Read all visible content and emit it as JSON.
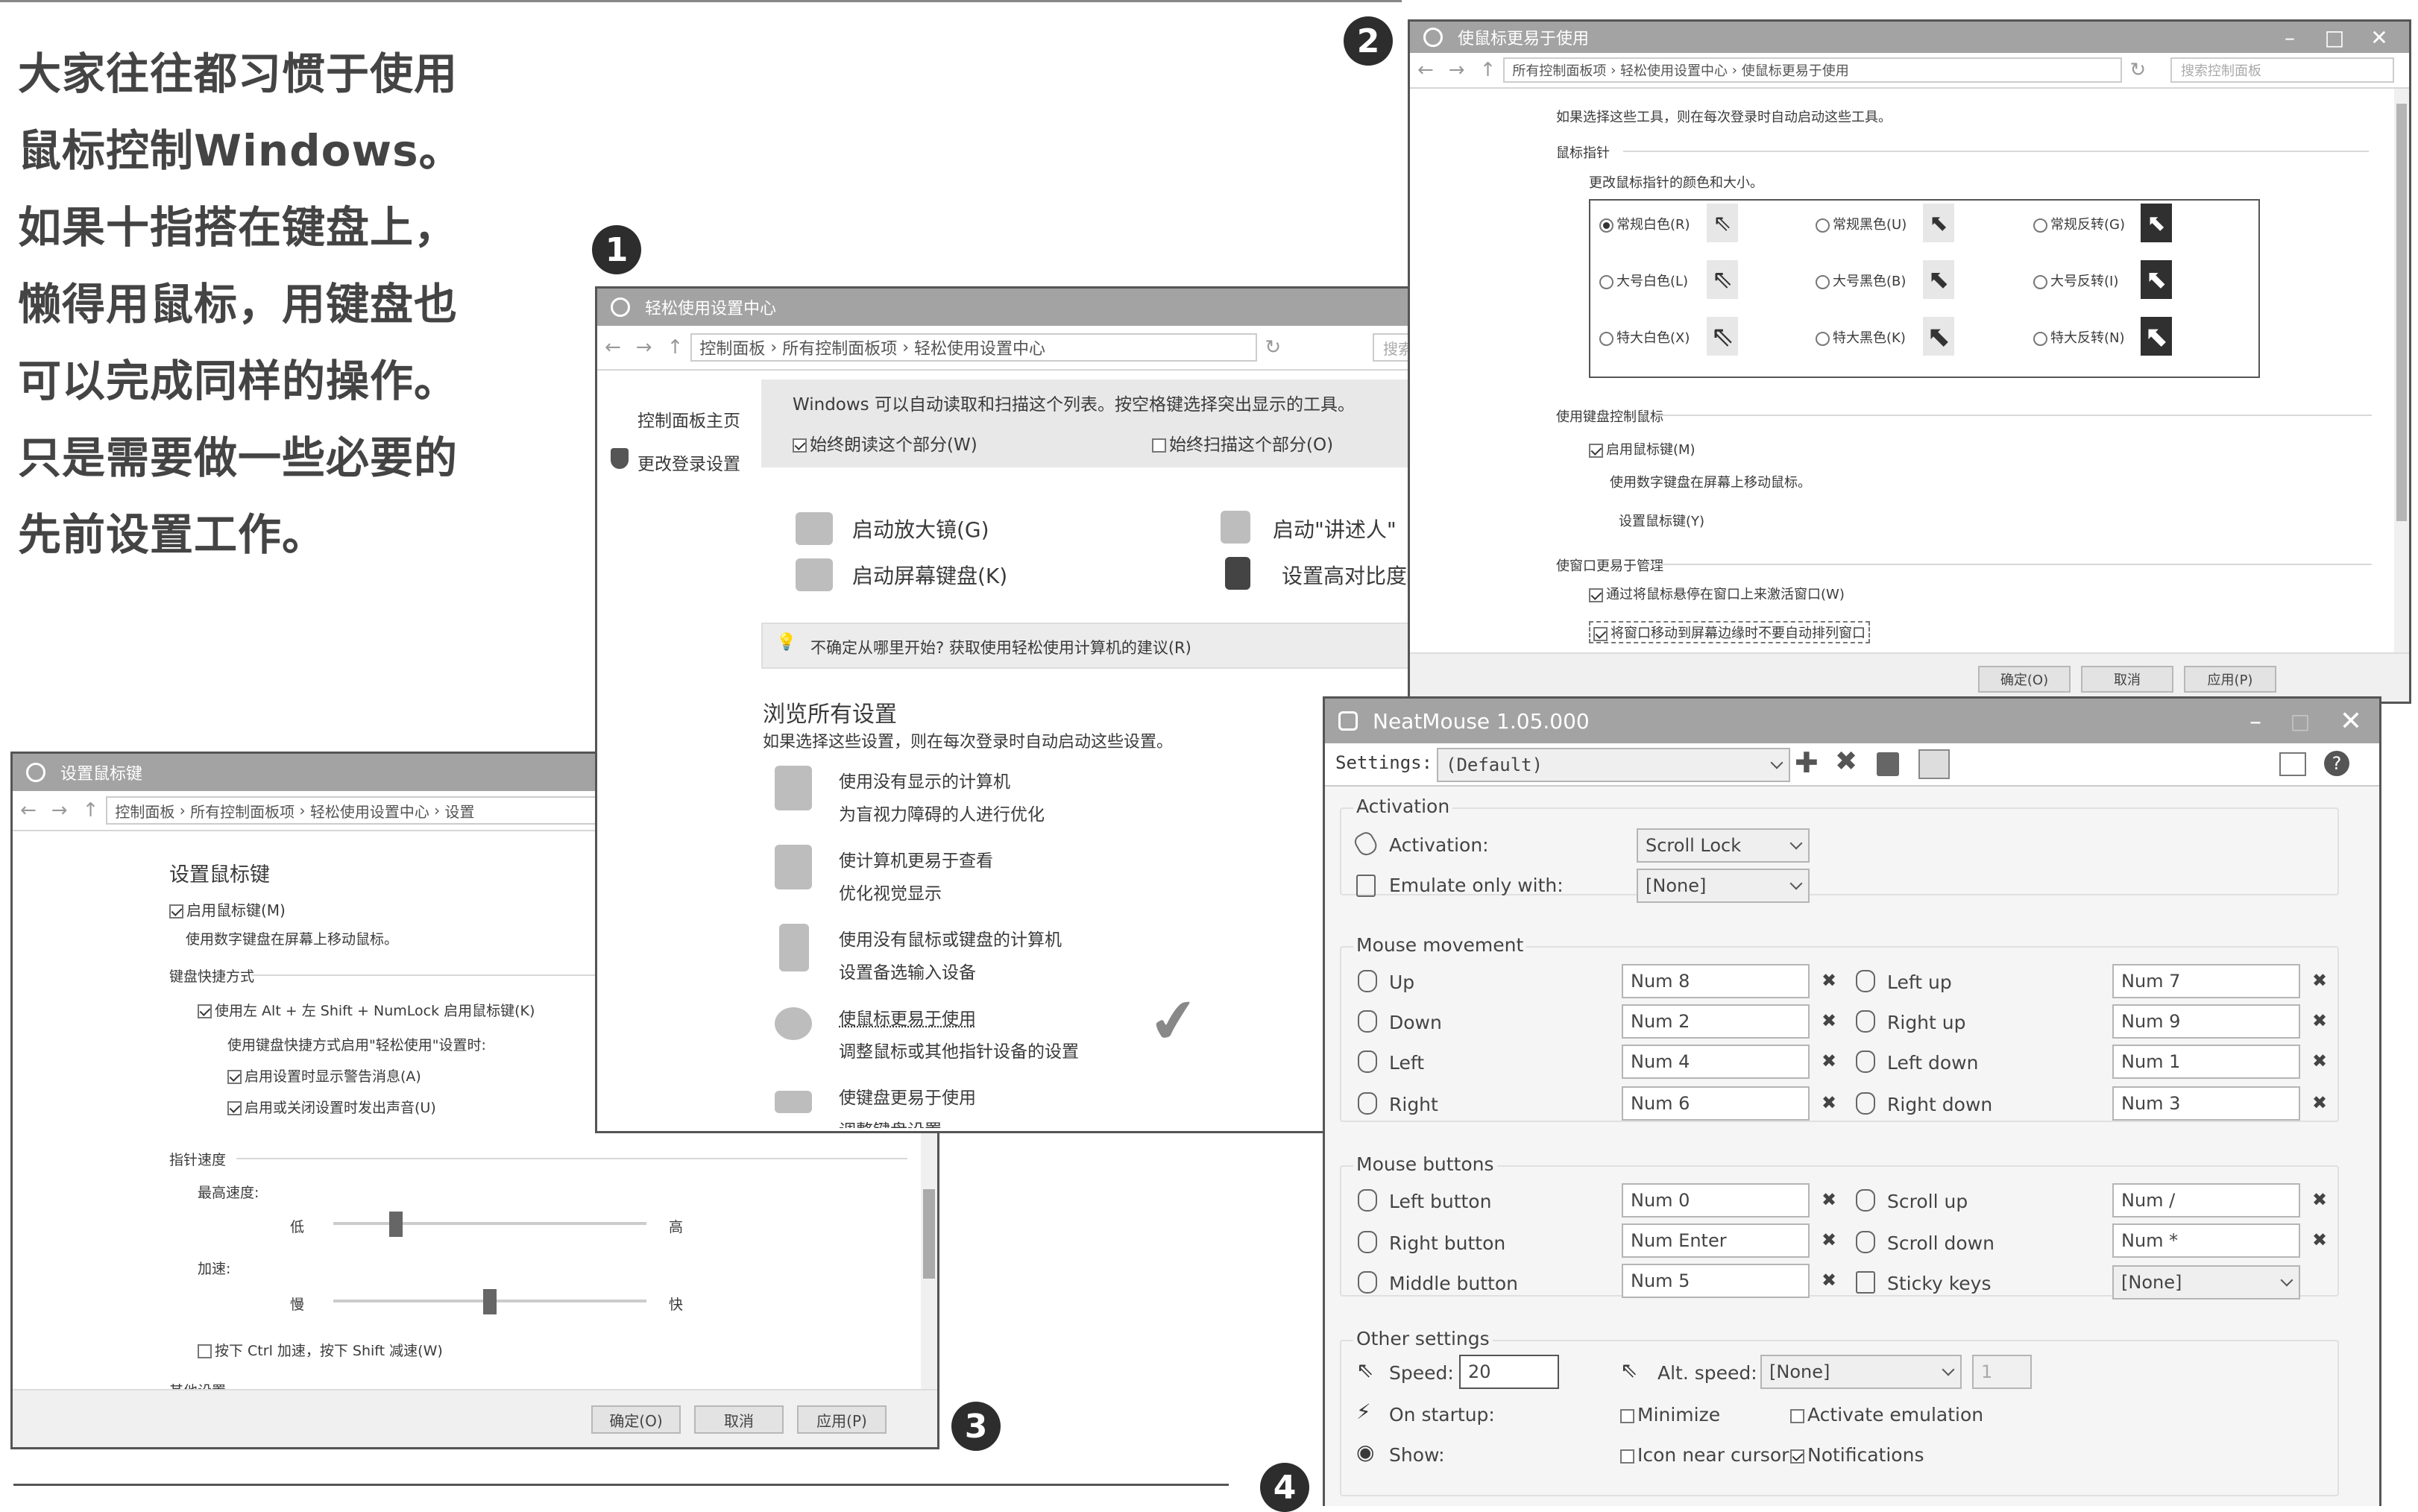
{
  "article": {
    "lines": [
      "大家往往都习惯于使用",
      "鼠标控制Windows。",
      "如果十指搭在键盘上，",
      "懒得用鼠标，用键盘也",
      "可以完成同样的操作。",
      "只是需要做一些必要的",
      "先前设置工作。"
    ],
    "badges": [
      "1",
      "2",
      "3",
      "4"
    ]
  },
  "win1": {
    "title": "轻松使用设置中心",
    "path": [
      "控制面板",
      "所有控制面板项",
      "轻松使用设置中心"
    ],
    "search": "搜索",
    "sidebar": [
      "控制面板主页",
      "更改登录设置"
    ],
    "intro": "Windows 可以自动读取和扫描这个列表。按空格键选择突出显示的工具。",
    "always_read": "始终朗读这个部分(W)",
    "always_scan": "始终扫描这个部分(O)",
    "tools": [
      "启动放大镜(G)",
      "启动\"讲述人\"",
      "启动屏幕键盘(K)",
      "设置高对比度"
    ],
    "hint": "不确定从哪里开始? 获取使用轻松使用计算机的建议(R)",
    "browse_title": "浏览所有设置",
    "browse_sub": "如果选择这些设置，则在每次登录时自动启动这些设置。",
    "items": [
      {
        "title": "使用没有显示的计算机",
        "desc": "为盲视力障碍的人进行优化"
      },
      {
        "title": "使计算机更易于查看",
        "desc": "优化视觉显示"
      },
      {
        "title": "使用没有鼠标或键盘的计算机",
        "desc": "设置备选输入设备"
      },
      {
        "title": "使鼠标更易于使用",
        "desc": "调整鼠标或其他指针设备的设置"
      },
      {
        "title": "使键盘更易于使用",
        "desc": "调整键盘设置"
      }
    ]
  },
  "win2": {
    "title": "使鼠标更易于使用",
    "path": [
      "所有控制面板项",
      "轻松使用设置中心",
      "使鼠标更易于使用"
    ],
    "search": "搜索控制面板",
    "top_line": "如果选择这些工具，则在每次登录时自动启动这些工具。",
    "pointers_title": "鼠标指针",
    "pointers_sub": "更改鼠标指针的颜色和大小。",
    "options": [
      {
        "label": "常规白色(R)",
        "checked": true
      },
      {
        "label": "常规黑色(U)",
        "checked": false
      },
      {
        "label": "常规反转(G)",
        "checked": false
      },
      {
        "label": "大号白色(L)",
        "checked": false
      },
      {
        "label": "大号黑色(B)",
        "checked": false
      },
      {
        "label": "大号反转(I)",
        "checked": false
      },
      {
        "label": "特大白色(X)",
        "checked": false
      },
      {
        "label": "特大黑色(K)",
        "checked": false
      },
      {
        "label": "特大反转(N)",
        "checked": false
      }
    ],
    "kb_title": "使用键盘控制鼠标",
    "mousekeys": "启用鼠标键(M)",
    "mousekeys_desc": "使用数字键盘在屏幕上移动鼠标。",
    "mousekeys_link": "设置鼠标键(Y)",
    "window_title": "使窗口更易于管理",
    "hover": "通过将鼠标悬停在窗口上来激活窗口(W)",
    "snap": "将窗口移动到屏幕边缘时不要自动排列窗口",
    "ok": "确定(O)",
    "cancel": "取消",
    "apply": "应用(P)"
  },
  "win3": {
    "title": "设置鼠标键",
    "path": [
      "控制面板",
      "所有控制面板项",
      "轻松使用设置中心",
      "设置"
    ],
    "heading": "设置鼠标键",
    "enable": "启用鼠标键(M)",
    "enable_desc": "使用数字键盘在屏幕上移动鼠标。",
    "shortcut_title": "键盘快捷方式",
    "shortcut": "使用左 Alt + 左 Shift + NumLock 启用鼠标键(K)",
    "shortcut_note": "使用键盘快捷方式启用\"轻松使用\"设置时:",
    "warn": "启用设置时显示警告消息(A)",
    "sound": "启用或关闭设置时发出声音(U)",
    "speed_title": "指针速度",
    "top_speed": "最高速度:",
    "low": "低",
    "high": "高",
    "accel": "加速:",
    "slow": "慢",
    "fast": "快",
    "top_speed_level": 0.2,
    "accel_level": 0.5,
    "ctrl_shift": "按下 Ctrl 加速，按下 Shift 减速(W)",
    "other_title": "其他设置",
    "ok": "确定(O)",
    "cancel": "取消",
    "apply": "应用(P)"
  },
  "win4": {
    "title": "NeatMouse 1.05.000",
    "settings_label": "Settings:",
    "settings_value": "(Default)",
    "activation_group": "Activation",
    "activation_label": "Activation:",
    "activation_value": "Scroll Lock",
    "emulate_label": "Emulate only with:",
    "emulate_value": "[None]",
    "movement_group": "Mouse movement",
    "movement_left": [
      {
        "label": "Up",
        "key": "Num 8"
      },
      {
        "label": "Down",
        "key": "Num 2"
      },
      {
        "label": "Left",
        "key": "Num 4"
      },
      {
        "label": "Right",
        "key": "Num 6"
      }
    ],
    "movement_right": [
      {
        "label": "Left up",
        "key": "Num 7"
      },
      {
        "label": "Right up",
        "key": "Num 9"
      },
      {
        "label": "Left down",
        "key": "Num 1"
      },
      {
        "label": "Right down",
        "key": "Num 3"
      }
    ],
    "buttons_group": "Mouse buttons",
    "buttons_left": [
      {
        "label": "Left button",
        "key": "Num 0"
      },
      {
        "label": "Right button",
        "key": "Num Enter"
      },
      {
        "label": "Middle button",
        "key": "Num 5"
      }
    ],
    "buttons_right": [
      {
        "label": "Scroll up",
        "key": "Num /"
      },
      {
        "label": "Scroll down",
        "key": "Num *"
      },
      {
        "label": "Sticky keys",
        "key": "[None]"
      }
    ],
    "other_group": "Other settings",
    "speed_label": "Speed:",
    "speed_value": "20",
    "alt_speed_label": "Alt. speed:",
    "alt_speed_value": "[None]",
    "alt_speed_num": "1",
    "startup_label": "On startup:",
    "minimize": "Minimize",
    "activate": "Activate emulation",
    "show_label": "Show:",
    "icon_near": "Icon near cursor",
    "notifications": "Notifications"
  },
  "colors": {
    "accent": "#a3a3a3",
    "text": "#3a3a3a",
    "badge": "#2d2d2d"
  }
}
